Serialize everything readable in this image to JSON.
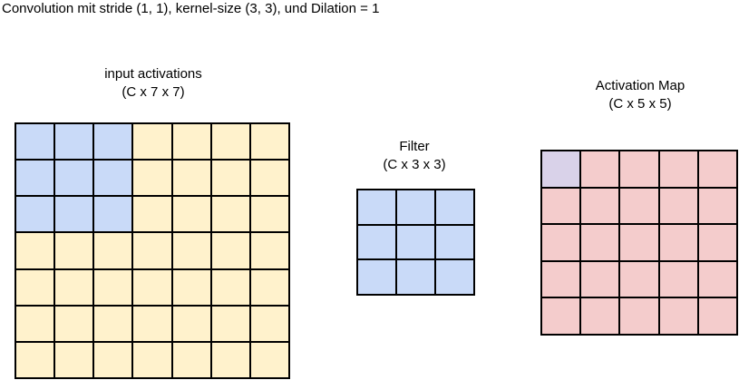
{
  "title": "Convolution mit stride (1, 1), kernel-size (3, 3), und Dilation = 1",
  "input": {
    "label_line1": "input activations",
    "label_line2": "(C x 7 x 7)",
    "rows": 7,
    "cols": 7,
    "base_color": "#fff2cc",
    "highlight_color": "#c9daf8",
    "highlight_rows": 3,
    "highlight_cols": 3
  },
  "filter": {
    "label_line1": "Filter",
    "label_line2": "(C x 3 x 3)",
    "rows": 3,
    "cols": 3,
    "base_color": "#c9daf8"
  },
  "output": {
    "label_line1": "Activation Map",
    "label_line2": "(C x 5 x 5)",
    "rows": 5,
    "cols": 5,
    "base_color": "#f4cccc",
    "highlight_color": "#d9d2e9",
    "highlight_rows": 1,
    "highlight_cols": 1
  }
}
